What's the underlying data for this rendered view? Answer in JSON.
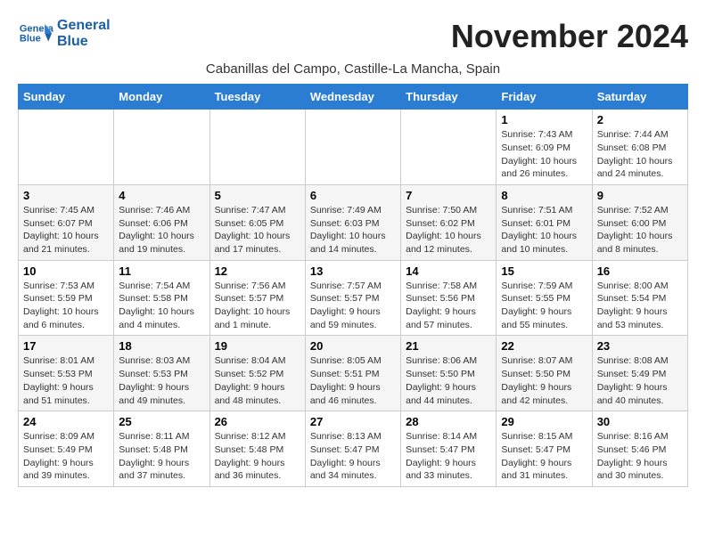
{
  "logo": {
    "line1": "General",
    "line2": "Blue"
  },
  "title": "November 2024",
  "subtitle": "Cabanillas del Campo, Castille-La Mancha, Spain",
  "days_of_week": [
    "Sunday",
    "Monday",
    "Tuesday",
    "Wednesday",
    "Thursday",
    "Friday",
    "Saturday"
  ],
  "weeks": [
    [
      {
        "day": "",
        "info": ""
      },
      {
        "day": "",
        "info": ""
      },
      {
        "day": "",
        "info": ""
      },
      {
        "day": "",
        "info": ""
      },
      {
        "day": "",
        "info": ""
      },
      {
        "day": "1",
        "info": "Sunrise: 7:43 AM\nSunset: 6:09 PM\nDaylight: 10 hours and 26 minutes."
      },
      {
        "day": "2",
        "info": "Sunrise: 7:44 AM\nSunset: 6:08 PM\nDaylight: 10 hours and 24 minutes."
      }
    ],
    [
      {
        "day": "3",
        "info": "Sunrise: 7:45 AM\nSunset: 6:07 PM\nDaylight: 10 hours and 21 minutes."
      },
      {
        "day": "4",
        "info": "Sunrise: 7:46 AM\nSunset: 6:06 PM\nDaylight: 10 hours and 19 minutes."
      },
      {
        "day": "5",
        "info": "Sunrise: 7:47 AM\nSunset: 6:05 PM\nDaylight: 10 hours and 17 minutes."
      },
      {
        "day": "6",
        "info": "Sunrise: 7:49 AM\nSunset: 6:03 PM\nDaylight: 10 hours and 14 minutes."
      },
      {
        "day": "7",
        "info": "Sunrise: 7:50 AM\nSunset: 6:02 PM\nDaylight: 10 hours and 12 minutes."
      },
      {
        "day": "8",
        "info": "Sunrise: 7:51 AM\nSunset: 6:01 PM\nDaylight: 10 hours and 10 minutes."
      },
      {
        "day": "9",
        "info": "Sunrise: 7:52 AM\nSunset: 6:00 PM\nDaylight: 10 hours and 8 minutes."
      }
    ],
    [
      {
        "day": "10",
        "info": "Sunrise: 7:53 AM\nSunset: 5:59 PM\nDaylight: 10 hours and 6 minutes."
      },
      {
        "day": "11",
        "info": "Sunrise: 7:54 AM\nSunset: 5:58 PM\nDaylight: 10 hours and 4 minutes."
      },
      {
        "day": "12",
        "info": "Sunrise: 7:56 AM\nSunset: 5:57 PM\nDaylight: 10 hours and 1 minute."
      },
      {
        "day": "13",
        "info": "Sunrise: 7:57 AM\nSunset: 5:57 PM\nDaylight: 9 hours and 59 minutes."
      },
      {
        "day": "14",
        "info": "Sunrise: 7:58 AM\nSunset: 5:56 PM\nDaylight: 9 hours and 57 minutes."
      },
      {
        "day": "15",
        "info": "Sunrise: 7:59 AM\nSunset: 5:55 PM\nDaylight: 9 hours and 55 minutes."
      },
      {
        "day": "16",
        "info": "Sunrise: 8:00 AM\nSunset: 5:54 PM\nDaylight: 9 hours and 53 minutes."
      }
    ],
    [
      {
        "day": "17",
        "info": "Sunrise: 8:01 AM\nSunset: 5:53 PM\nDaylight: 9 hours and 51 minutes."
      },
      {
        "day": "18",
        "info": "Sunrise: 8:03 AM\nSunset: 5:53 PM\nDaylight: 9 hours and 49 minutes."
      },
      {
        "day": "19",
        "info": "Sunrise: 8:04 AM\nSunset: 5:52 PM\nDaylight: 9 hours and 48 minutes."
      },
      {
        "day": "20",
        "info": "Sunrise: 8:05 AM\nSunset: 5:51 PM\nDaylight: 9 hours and 46 minutes."
      },
      {
        "day": "21",
        "info": "Sunrise: 8:06 AM\nSunset: 5:50 PM\nDaylight: 9 hours and 44 minutes."
      },
      {
        "day": "22",
        "info": "Sunrise: 8:07 AM\nSunset: 5:50 PM\nDaylight: 9 hours and 42 minutes."
      },
      {
        "day": "23",
        "info": "Sunrise: 8:08 AM\nSunset: 5:49 PM\nDaylight: 9 hours and 40 minutes."
      }
    ],
    [
      {
        "day": "24",
        "info": "Sunrise: 8:09 AM\nSunset: 5:49 PM\nDaylight: 9 hours and 39 minutes."
      },
      {
        "day": "25",
        "info": "Sunrise: 8:11 AM\nSunset: 5:48 PM\nDaylight: 9 hours and 37 minutes."
      },
      {
        "day": "26",
        "info": "Sunrise: 8:12 AM\nSunset: 5:48 PM\nDaylight: 9 hours and 36 minutes."
      },
      {
        "day": "27",
        "info": "Sunrise: 8:13 AM\nSunset: 5:47 PM\nDaylight: 9 hours and 34 minutes."
      },
      {
        "day": "28",
        "info": "Sunrise: 8:14 AM\nSunset: 5:47 PM\nDaylight: 9 hours and 33 minutes."
      },
      {
        "day": "29",
        "info": "Sunrise: 8:15 AM\nSunset: 5:47 PM\nDaylight: 9 hours and 31 minutes."
      },
      {
        "day": "30",
        "info": "Sunrise: 8:16 AM\nSunset: 5:46 PM\nDaylight: 9 hours and 30 minutes."
      }
    ]
  ]
}
